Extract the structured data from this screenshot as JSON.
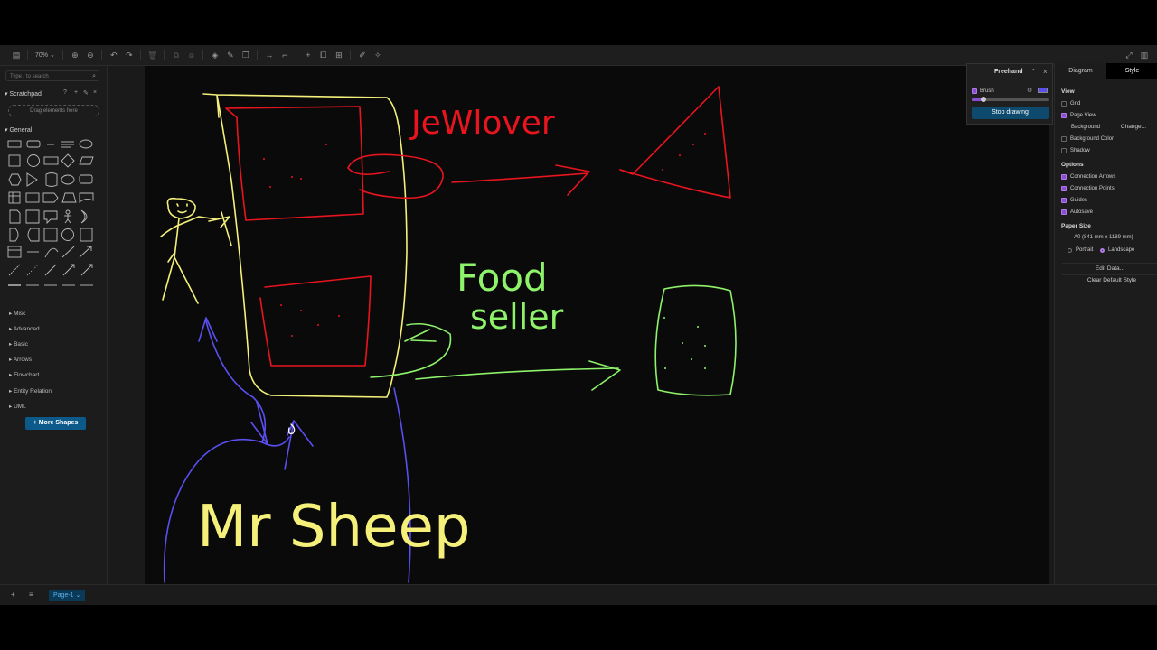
{
  "toolbar": {
    "zoom": "70%"
  },
  "sidebar": {
    "search_placeholder": "Type / to search",
    "scratchpad": "Scratchpad",
    "drag_hint": "Drag elements here",
    "general": "General",
    "categories": [
      "Misc",
      "Advanced",
      "Basic",
      "Arrows",
      "Flowchart",
      "Entity Relation",
      "UML"
    ],
    "more_shapes": "+ More Shapes"
  },
  "canvas": {
    "drawing": {
      "label_jewlover": "JeWlover",
      "label_food": "Food",
      "label_seller": "seller",
      "label_mr_sheep": "Mr Sheep"
    },
    "colors": {
      "yellow": "#f4f07a",
      "red": "#e8141e",
      "green": "#8ef26a",
      "blue": "#5a4ff0"
    }
  },
  "freehand": {
    "title": "Freehand",
    "brush_label": "Brush",
    "stop_label": "Stop drawing",
    "brush_color": "#5b4ef0"
  },
  "right_panel": {
    "tab_diagram": "Diagram",
    "tab_style": "Style",
    "view_heading": "View",
    "grid": "Grid",
    "page_view": "Page View",
    "background": "Background",
    "change": "Change...",
    "background_color": "Background Color",
    "shadow": "Shadow",
    "options_heading": "Options",
    "connection_arrows": "Connection Arrows",
    "connection_points": "Connection Points",
    "guides": "Guides",
    "autosave": "Autosave",
    "paper_size_heading": "Paper Size",
    "paper_size_value": "A0 (841 mm x 1189 mm)",
    "portrait": "Portrait",
    "landscape": "Landscape",
    "edit_data": "Edit Data...",
    "clear_default_style": "Clear Default Style"
  },
  "bottom": {
    "page_tab": "Page-1"
  }
}
